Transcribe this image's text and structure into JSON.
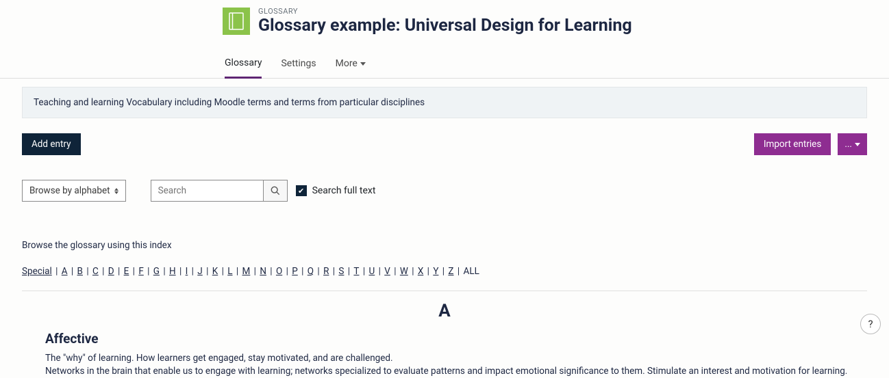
{
  "header": {
    "breadcrumb": "GLOSSARY",
    "title": "Glossary example: Universal Design for Learning"
  },
  "tabs": {
    "items": [
      {
        "label": "Glossary",
        "active": true
      },
      {
        "label": "Settings",
        "active": false
      },
      {
        "label": "More",
        "active": false,
        "has_dropdown": true
      }
    ]
  },
  "description": "Teaching and learning Vocabulary including Moodle terms and terms from particular disciplines",
  "actions": {
    "add_entry": "Add entry",
    "import_entries": "Import entries",
    "more_menu": "..."
  },
  "browse": {
    "select_label": "Browse by alphabet",
    "search_placeholder": "Search",
    "search_full_text": "Search full text",
    "search_full_text_checked": true,
    "index_label": "Browse the glossary using this index",
    "index": [
      "Special",
      "A",
      "B",
      "C",
      "D",
      "E",
      "F",
      "G",
      "H",
      "I",
      "J",
      "K",
      "L",
      "M",
      "N",
      "O",
      "P",
      "Q",
      "R",
      "S",
      "T",
      "U",
      "V",
      "W",
      "X",
      "Y",
      "Z",
      "ALL"
    ],
    "current_index": "ALL"
  },
  "section": {
    "letter": "A",
    "entries": [
      {
        "title": "Affective",
        "line1": "The \"why\" of learning. How learners get engaged, stay motivated, and are challenged.",
        "line2": "Networks in the brain that enable us to engage with learning; networks specialized to evaluate patterns and impact emotional significance to them. Stimulate an interest and motivation for learning."
      }
    ]
  },
  "help": "?"
}
